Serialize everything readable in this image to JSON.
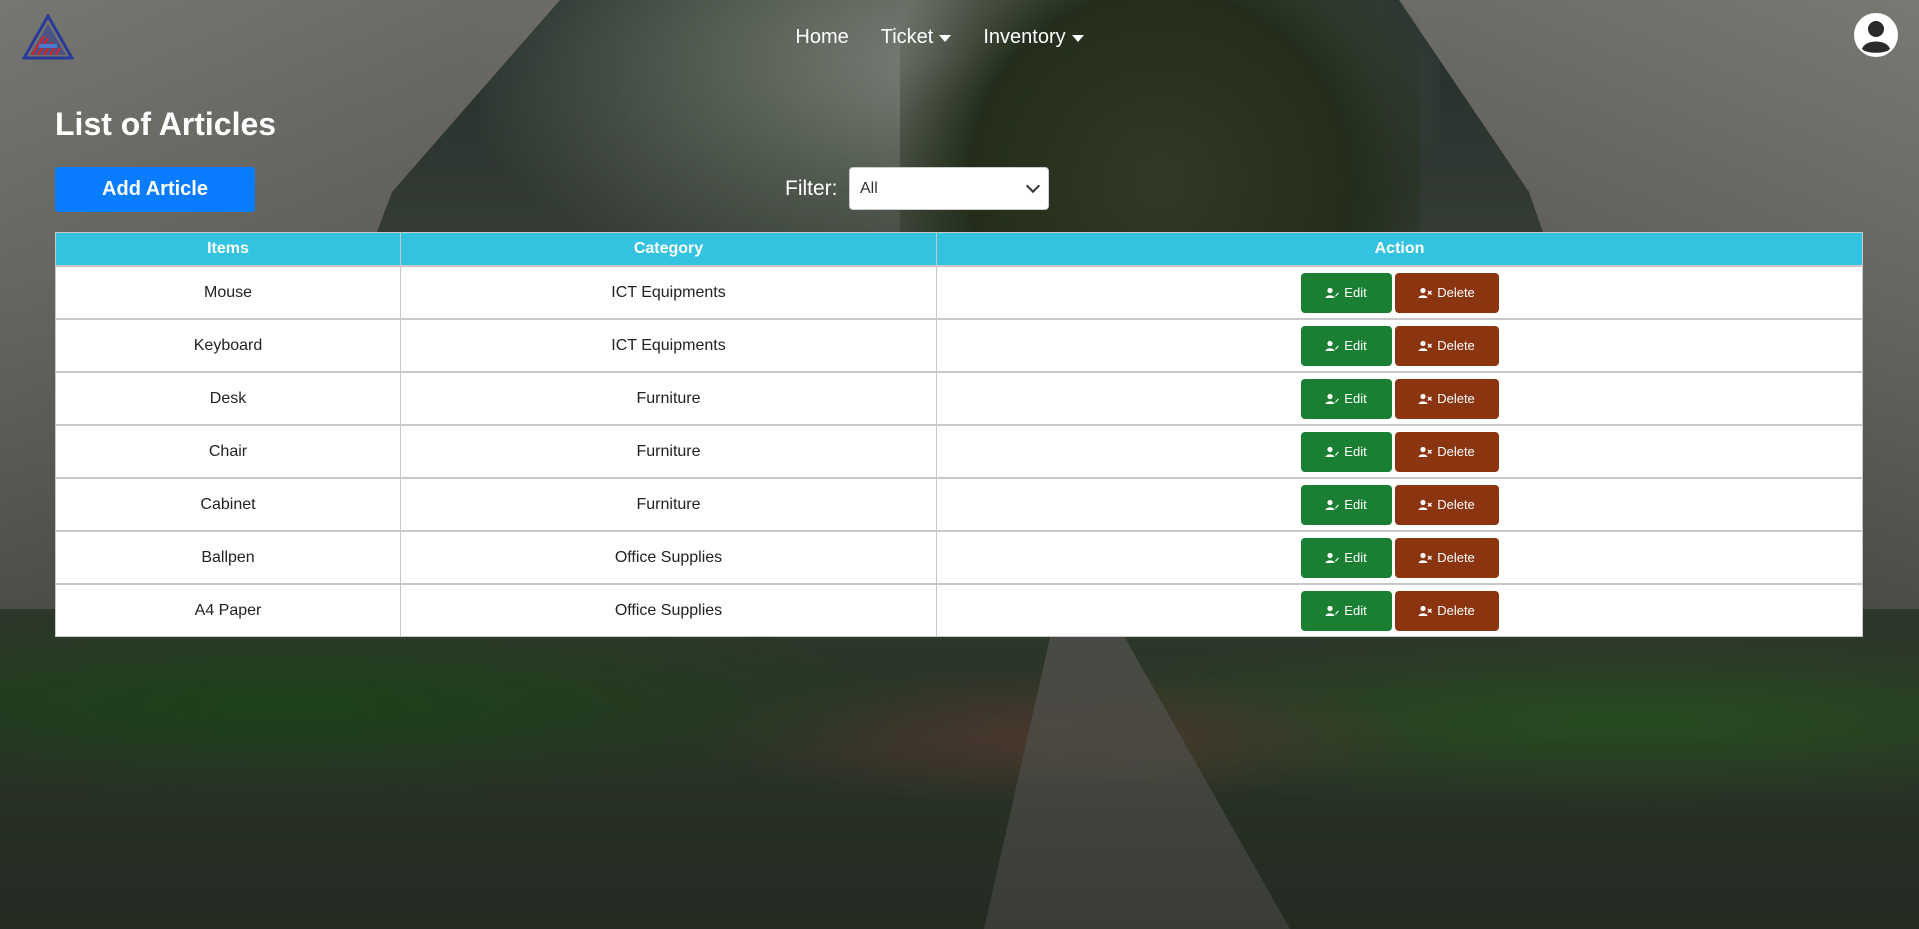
{
  "nav": {
    "links": [
      {
        "label": "Home",
        "dropdown": false
      },
      {
        "label": "Ticket",
        "dropdown": true
      },
      {
        "label": "Inventory",
        "dropdown": true
      }
    ],
    "logo_icon": "triangle-logo-icon",
    "user_icon": "user-circle-icon"
  },
  "page": {
    "title": "List of Articles",
    "add_button": "Add Article",
    "filter_label": "Filter:",
    "filter_value": "All"
  },
  "table": {
    "headers": [
      "Items",
      "Category",
      "Action"
    ],
    "rows": [
      {
        "item": "Mouse",
        "category": "ICT Equipments"
      },
      {
        "item": "Keyboard",
        "category": "ICT Equipments"
      },
      {
        "item": "Desk",
        "category": "Furniture"
      },
      {
        "item": "Chair",
        "category": "Furniture"
      },
      {
        "item": "Cabinet",
        "category": "Furniture"
      },
      {
        "item": "Ballpen",
        "category": "Office Supplies"
      },
      {
        "item": "A4 Paper",
        "category": "Office Supplies"
      }
    ],
    "edit_label": "Edit",
    "delete_label": "Delete"
  },
  "colors": {
    "header_bg": "#33c3e0",
    "add_button": "#0a7cff",
    "edit_button": "#1a7f33",
    "delete_button": "#8a3510"
  }
}
